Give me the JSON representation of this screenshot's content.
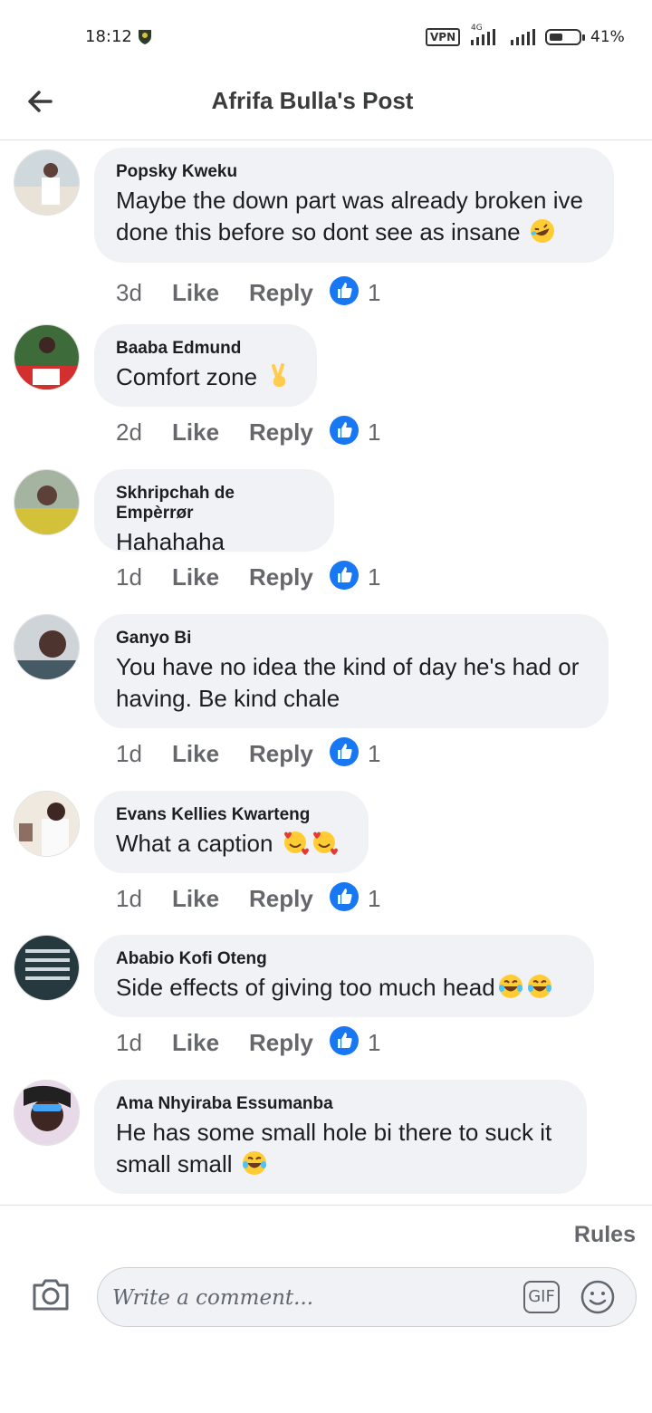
{
  "status_bar": {
    "time": "18:12",
    "vpn": "VPN",
    "network": "4G",
    "battery": "41%"
  },
  "header": {
    "title": "Afrifa Bulla's Post"
  },
  "comments": [
    {
      "author": "Popsky Kweku",
      "text": "Maybe the down part was already broken ive done this before so dont see as insane",
      "emojis": [
        "rofl"
      ],
      "time": "3d",
      "like": "Like",
      "reply": "Reply",
      "reactions": "1"
    },
    {
      "author": "Baaba Edmund",
      "text": "Comfort zone",
      "emojis": [
        "victory-hand"
      ],
      "time": "2d",
      "like": "Like",
      "reply": "Reply",
      "reactions": "1"
    },
    {
      "author": "Skhripchah de Empèrrør",
      "text": "Hahahaha",
      "emojis": [],
      "time": "1d",
      "like": "Like",
      "reply": "Reply",
      "reactions": "1"
    },
    {
      "author": "Ganyo Bi",
      "text": "You have no idea the kind of day he's had or having. Be kind chale",
      "emojis": [],
      "time": "1d",
      "like": "Like",
      "reply": "Reply",
      "reactions": "1"
    },
    {
      "author": "Evans Kellies Kwarteng",
      "text": "What a caption",
      "emojis": [
        "smiling-face-with-hearts",
        "smiling-face-with-hearts"
      ],
      "time": "1d",
      "like": "Like",
      "reply": "Reply",
      "reactions": "1"
    },
    {
      "author": "Ababio Kofi Oteng",
      "text": "Side effects of giving too much head",
      "emojis": [
        "tears-of-joy",
        "tears-of-joy"
      ],
      "time": "1d",
      "like": "Like",
      "reply": "Reply",
      "reactions": "1"
    },
    {
      "author": "Ama Nhyiraba Essumanba",
      "text": "He has some small hole bi there to suck it small small",
      "emojis": [
        "tears-of-joy"
      ],
      "time": "",
      "like": "",
      "reply": "",
      "reactions": ""
    }
  ],
  "footer": {
    "rules": "Rules",
    "input_placeholder": "Write a comment...",
    "gif": "GIF"
  },
  "colors": {
    "like_blue": "#1877f2",
    "bubble_gray": "#f0f2f5",
    "secondary_text": "#65676b"
  }
}
